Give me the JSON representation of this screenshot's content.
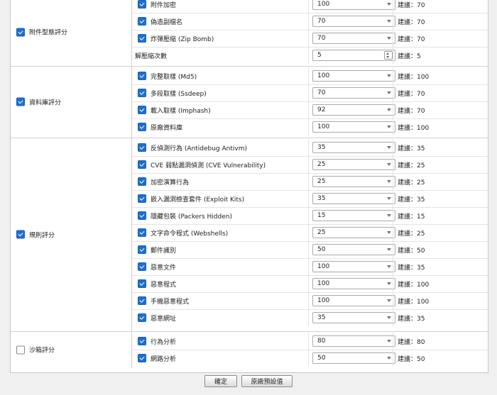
{
  "sections": {
    "attach": {
      "label": "附件型態評分",
      "checked": true,
      "rows": [
        {
          "name": "附件加密",
          "checked": true,
          "value": "100",
          "score": "建議：70"
        },
        {
          "name": "偽造副檔名",
          "checked": true,
          "value": "70",
          "score": "建議：70"
        },
        {
          "name": "炸彈壓縮 (Zip Bomb)",
          "checked": true,
          "value": "70",
          "score": "建議：70"
        },
        {
          "name": "解壓縮次數",
          "checked": false,
          "value": "5",
          "score": "建議：5"
        }
      ]
    },
    "db": {
      "label": "資料庫評分",
      "checked": true,
      "rows": [
        {
          "name": "完整取樣 (Md5)",
          "checked": true,
          "value": "100",
          "score": "建議：100"
        },
        {
          "name": "多段取樣 (Ssdeep)",
          "checked": true,
          "value": "70",
          "score": "建議：70"
        },
        {
          "name": "載入取樣 (Imphash)",
          "checked": true,
          "value": "92",
          "score": "建議：70"
        },
        {
          "name": "原廠資料庫",
          "checked": true,
          "value": "100",
          "score": "建議：100"
        }
      ]
    },
    "rules": {
      "label": "規則評分",
      "checked": true,
      "rows": [
        {
          "name": "反偵測行為 (Antidebug Antivm)",
          "checked": true,
          "value": "35",
          "score": "建議：35"
        },
        {
          "name": "CVE 弱點漏洞偵測 (CVE Vulnerability)",
          "checked": true,
          "value": "25",
          "score": "建議：25"
        },
        {
          "name": "加密演算行為",
          "checked": true,
          "value": "25",
          "score": "建議：25"
        },
        {
          "name": "嵌入漏洞檢查套件 (Exploit Kits)",
          "checked": true,
          "value": "35",
          "score": "建議：35"
        },
        {
          "name": "隱藏包裝 (Packers Hidden)",
          "checked": true,
          "value": "15",
          "score": "建議：15"
        },
        {
          "name": "文字命令程式 (Webshells)",
          "checked": true,
          "value": "25",
          "score": "建議：25"
        },
        {
          "name": "郵件識別",
          "checked": true,
          "value": "50",
          "score": "建議：50"
        },
        {
          "name": "惡意文件",
          "checked": true,
          "value": "100",
          "score": "建議：35"
        },
        {
          "name": "惡意程式",
          "checked": true,
          "value": "100",
          "score": "建議：100"
        },
        {
          "name": "手機惡意程式",
          "checked": true,
          "value": "100",
          "score": "建議：100"
        },
        {
          "name": "惡意網址",
          "checked": true,
          "value": "35",
          "score": "建議：35"
        }
      ]
    },
    "sandbox": {
      "label": "沙箱評分",
      "checked": false,
      "rows": [
        {
          "name": "行為分析",
          "checked": true,
          "value": "80",
          "score": "建議：80"
        },
        {
          "name": "網路分析",
          "checked": true,
          "value": "50",
          "score": "建議：50"
        }
      ]
    }
  },
  "buttons": {
    "confirm": "確定",
    "reset": "原廠預設值"
  },
  "colors": {
    "accent": "#1e6fd0",
    "border": "#c8c8c8"
  }
}
